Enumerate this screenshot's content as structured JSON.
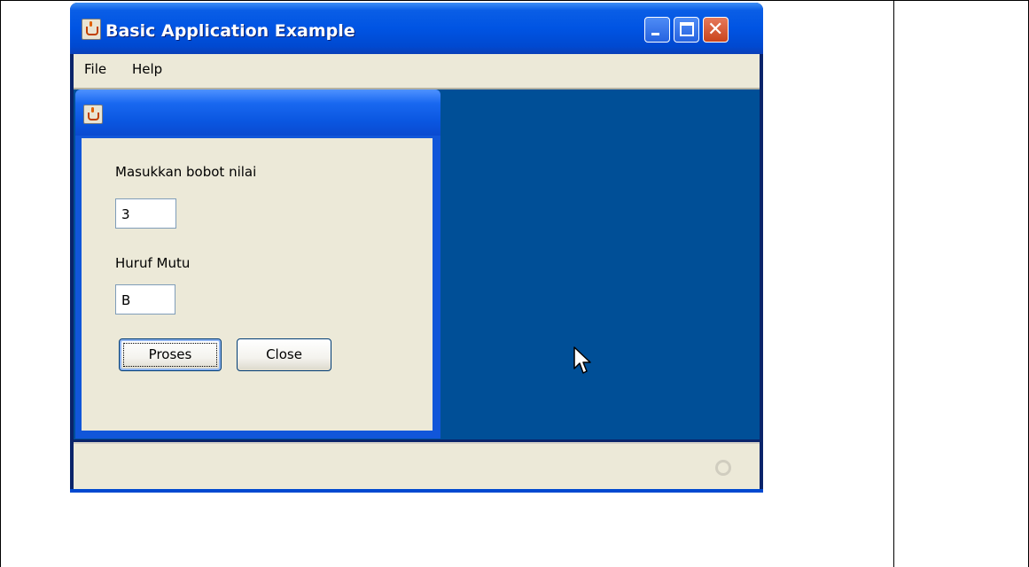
{
  "window": {
    "title": "Basic Application Example",
    "controls": [
      "minimize-icon",
      "maximize-icon",
      "close-icon"
    ],
    "close_glyph": "✕"
  },
  "menubar": {
    "items": [
      "File",
      "Help"
    ]
  },
  "internal_frame": {
    "fields": [
      {
        "label": "Masukkan bobot nilai",
        "value": "3"
      },
      {
        "label": "Huruf Mutu",
        "value": "B"
      }
    ],
    "buttons": {
      "process": "Proses",
      "close": "Close"
    }
  },
  "statusbar": {
    "busy_icon": "busy-indicator-icon"
  },
  "colors": {
    "title_bar": "#0054e3",
    "desktop": "#004f97",
    "panel": "#ece9d8",
    "close_button": "#c9441c"
  }
}
